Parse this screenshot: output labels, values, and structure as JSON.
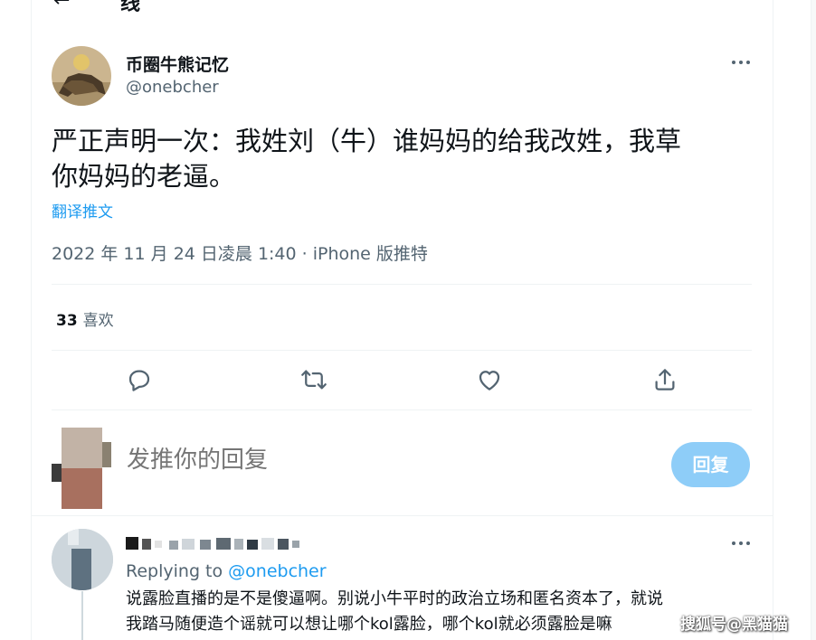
{
  "header": {
    "back_icon": "back-arrow-icon",
    "title": "线"
  },
  "tweet": {
    "author": {
      "display_name": "币圈牛熊记忆",
      "handle": "@onebcher"
    },
    "text_line1": "严正声明一次：我姓刘（牛）谁妈妈的给我改姓，我草",
    "text_line2": "你妈妈的老逼。",
    "translate_label": "翻译推文",
    "meta": "2022 年 11 月 24 日凌晨 1:40 · iPhone 版推特",
    "likes": {
      "count": "33",
      "label": "喜欢"
    },
    "actions": [
      "reply-icon",
      "retweet-icon",
      "like-icon",
      "share-icon"
    ]
  },
  "composer": {
    "placeholder": "发推你的回复",
    "button_label": "回复"
  },
  "reply": {
    "replying_prefix": "Replying to ",
    "replying_handle": "@onebcher",
    "text_line1": "说露脸直播的是不是傻逼啊。别说小牛平时的政治立场和匿名资本了，就说",
    "text_line2": "我踏马随便造个谣就可以想让哪个kol露脸，哪个kol就必须露脸是嘛"
  },
  "watermark": "搜狐号@黑猫猫",
  "colors": {
    "accent": "#1d9bf0",
    "button_disabled": "#8ecdf8",
    "secondary_text": "#536471",
    "divider": "#eff3f4"
  }
}
